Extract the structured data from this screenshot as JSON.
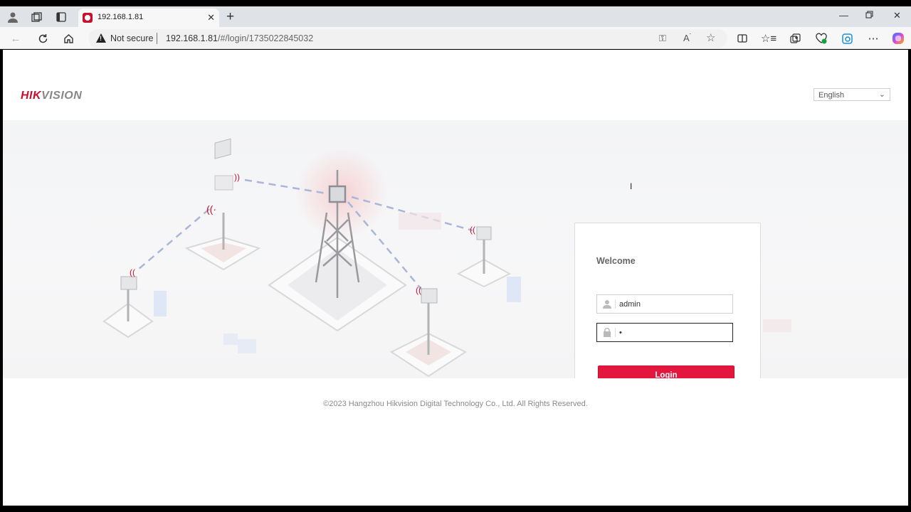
{
  "browser": {
    "tab_title": "192.168.1.81",
    "security_label": "Not secure",
    "url_host": "192.168.1.81",
    "url_path": "/#/login/1735022845032",
    "icons": [
      "profile-icon",
      "workspaces-icon",
      "tab-actions-icon",
      "back-icon",
      "refresh-icon",
      "home-icon",
      "key-icon",
      "read-aloud-icon",
      "favorite-icon",
      "split-screen-icon",
      "favorites-icon",
      "collections-icon",
      "browser-essentials-icon",
      "edge-icon",
      "more-icon",
      "copilot-icon"
    ]
  },
  "header": {
    "logo_red": "HIK",
    "logo_grey": "VISION",
    "language": "English"
  },
  "login": {
    "welcome": "Welcome",
    "username": "admin",
    "password_masked": "•",
    "login_button": "Login"
  },
  "footer": {
    "copyright": "©2023 Hangzhou Hikvision Digital Technology Co., Ltd. All Rights Reserved."
  },
  "colors": {
    "brand_red": "#c8102e",
    "button_red": "#e3173e"
  }
}
